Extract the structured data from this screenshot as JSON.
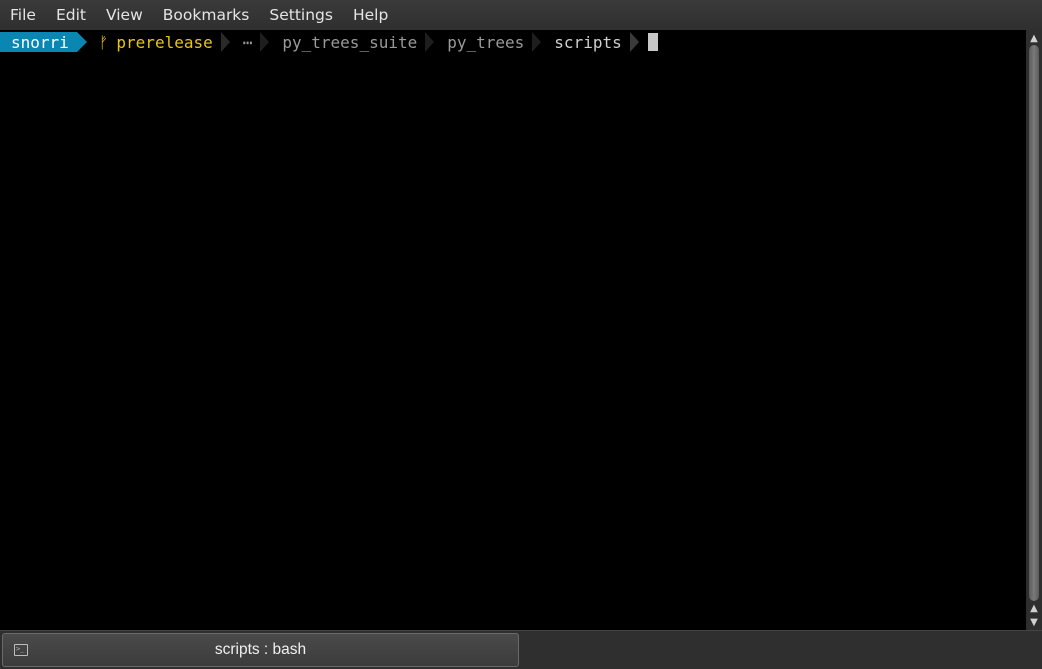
{
  "menubar": {
    "items": [
      "File",
      "Edit",
      "View",
      "Bookmarks",
      "Settings",
      "Help"
    ]
  },
  "prompt": {
    "user": "snorri",
    "git_icon": "ᚠ",
    "branch": "prerelease",
    "ellipsis": "⋯",
    "path": [
      "py_trees_suite",
      "py_trees",
      "scripts"
    ]
  },
  "tab": {
    "label": "scripts : bash",
    "icon": "terminal-icon"
  },
  "colors": {
    "user_bg": "#0a86b3",
    "branch_fg": "#e8c614",
    "path_fg": "#9a9a9a"
  }
}
